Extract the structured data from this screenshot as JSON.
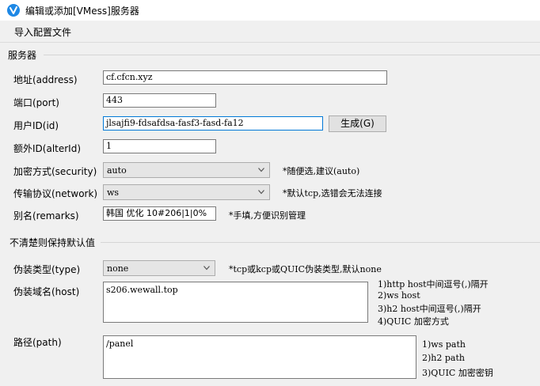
{
  "window": {
    "title": "编辑或添加[VMess]服务器"
  },
  "menu": {
    "import_config": "导入配置文件"
  },
  "server_group": {
    "label": "服务器"
  },
  "fields": {
    "address": {
      "label": "地址(address)",
      "value": "cf.cfcn.xyz"
    },
    "port": {
      "label": "端口(port)",
      "value": "443"
    },
    "user_id": {
      "label": "用户ID(id)",
      "value": "jlsajfi9-fdsafdsa-fasf3-fasd-fa12"
    },
    "generate_button": "生成(G)",
    "alter_id": {
      "label": "额外ID(alterId)",
      "value": "1"
    },
    "security": {
      "label": "加密方式(security)",
      "value": "auto",
      "hint": "*随便选,建议(auto)"
    },
    "network": {
      "label": "传输协议(network)",
      "value": "ws",
      "hint": "*默认tcp,选错会无法连接"
    },
    "remarks": {
      "label": "别名(remarks)",
      "value": "韩国 优化  10#206|1|0%",
      "hint": "*手填,方便识别管理"
    }
  },
  "advanced_group": {
    "label": "不清楚则保持默认值"
  },
  "advanced": {
    "type": {
      "label": "伪装类型(type)",
      "value": "none",
      "hint": "*tcp或kcp或QUIC伪装类型,默认none"
    },
    "host": {
      "label": "伪装域名(host)",
      "value": "s206.wewall.top",
      "notes": [
        "1)http host中间逗号(,)隔开",
        "2)ws host",
        "3)h2 host中间逗号(,)隔开",
        "4)QUIC 加密方式"
      ]
    },
    "path": {
      "label": "路径(path)",
      "value": "/panel",
      "notes": [
        "1)ws path",
        "2)h2 path",
        "3)QUIC 加密密钥"
      ]
    }
  },
  "colors": {
    "accent": "#0078d7",
    "window_bg": "#f0f0f0"
  },
  "icons": {
    "app": "v2rayn-v-logo-icon",
    "dropdown": "chevron-down-icon"
  }
}
